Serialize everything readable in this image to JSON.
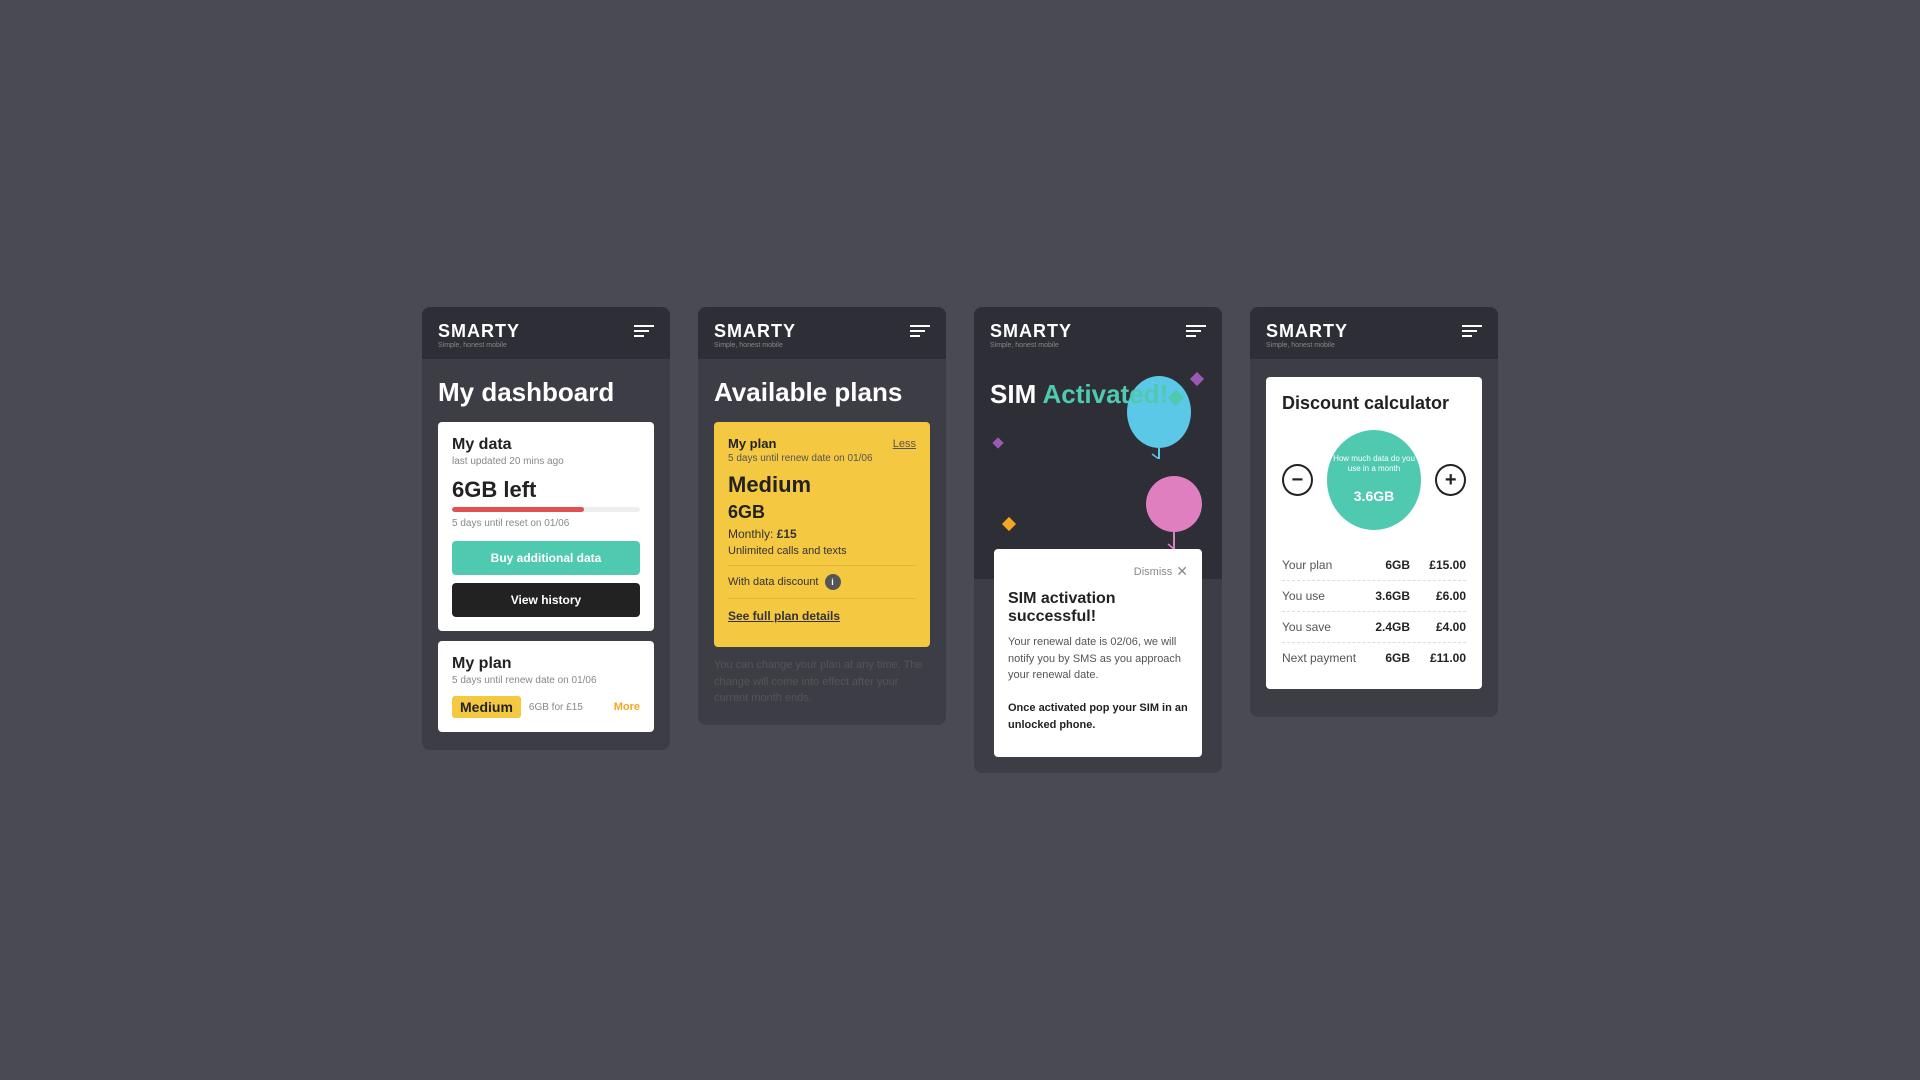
{
  "screens": [
    {
      "id": "dashboard",
      "brand": "SMARTY",
      "tagline": "Simple, honest mobile",
      "page_title": "My dashboard",
      "data_section": {
        "title": "My data",
        "subtitle": "last updated 20 mins ago",
        "data_left": "6GB left",
        "progress_percent": 70,
        "reset_text": "5 days until reset on 01/06",
        "btn_buy": "Buy additional data",
        "btn_history": "View history"
      },
      "plan_section": {
        "title": "My plan",
        "subtitle": "5 days until renew date on 01/06",
        "plan_name": "Medium",
        "plan_details": "6GB for £15",
        "more_link": "More"
      }
    },
    {
      "id": "available-plans",
      "brand": "SMARTY",
      "tagline": "Simple, honest mobile",
      "page_title": "Available plans",
      "my_plan": {
        "label": "My plan",
        "subtitle": "5 days until renew date on 01/06",
        "name": "Medium",
        "less_link": "Less",
        "size": "6GB",
        "monthly_label": "Monthly:",
        "monthly_price": "£15",
        "calls_text": "Unlimited calls and texts",
        "discount_label": "With data discount",
        "see_details": "See full plan details"
      },
      "change_text": "You can change your plan at any time. The change will come into effect after your current month ends."
    },
    {
      "id": "sim-activated",
      "brand": "SMARTY",
      "tagline": "Simple, honest mobile",
      "activated_title_1": "SIM Activated!",
      "popup": {
        "dismiss": "Dismiss",
        "title": "SIM activation successful!",
        "body": "Your renewal date is 02/06, we will notify you by SMS as you approach your renewal date.",
        "bold_text": "Once activated pop your SIM in an unlocked phone."
      }
    },
    {
      "id": "discount-calc",
      "brand": "SMARTY",
      "tagline": "Simple, honest mobile",
      "title": "Discount calculator",
      "gauge": {
        "label": "How much data do you use in a month",
        "value": "3.6",
        "unit": "GB"
      },
      "rows": [
        {
          "label": "Your plan",
          "gb": "6GB",
          "price": "£15.00"
        },
        {
          "label": "You use",
          "gb": "3.6GB",
          "price": "£6.00"
        },
        {
          "label": "You save",
          "gb": "2.4GB",
          "price": "£4.00"
        },
        {
          "label": "Next payment",
          "gb": "6GB",
          "price": "£11.00"
        }
      ]
    }
  ]
}
